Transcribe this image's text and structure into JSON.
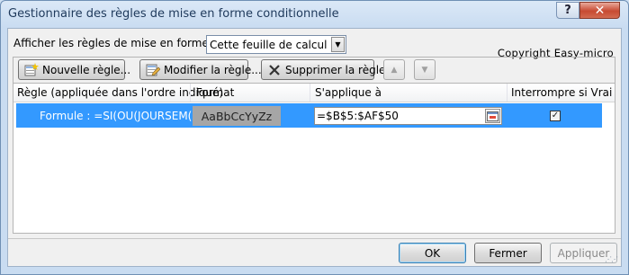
{
  "window": {
    "title": "Gestionnaire des règles de mise en forme conditionnelle",
    "help_label": "?",
    "close_label": "✕"
  },
  "show_rules": {
    "label": "Afficher les règles de mise en forme pour :",
    "selected": "Cette feuille de calcul"
  },
  "copyright": "Copyright Easy-micro",
  "toolbar": {
    "new_rule_label": "Nouvelle règle...",
    "edit_rule_label": "Modifier la règle...",
    "delete_rule_label": "Supprimer la règle",
    "move_up_label": "▲",
    "move_down_label": "▼"
  },
  "table": {
    "headers": [
      "Règle (appliquée dans l'ordre indiqué)",
      "Format",
      "S'applique à",
      "Interrompre si Vrai"
    ],
    "rows": [
      {
        "rule": "Formule : =SI(OU(JOURSEM(B...",
        "format_preview": "AaBbCcYyZz",
        "applies_to": "=$B$5:$AF$50",
        "stop_if_true": true,
        "check_glyph": "✓"
      }
    ]
  },
  "footer": {
    "ok_label": "OK",
    "close_label": "Fermer",
    "apply_label": "Appliquer"
  },
  "colors": {
    "selection": "#3399ff",
    "preview_bg": "#a6a6a6"
  }
}
